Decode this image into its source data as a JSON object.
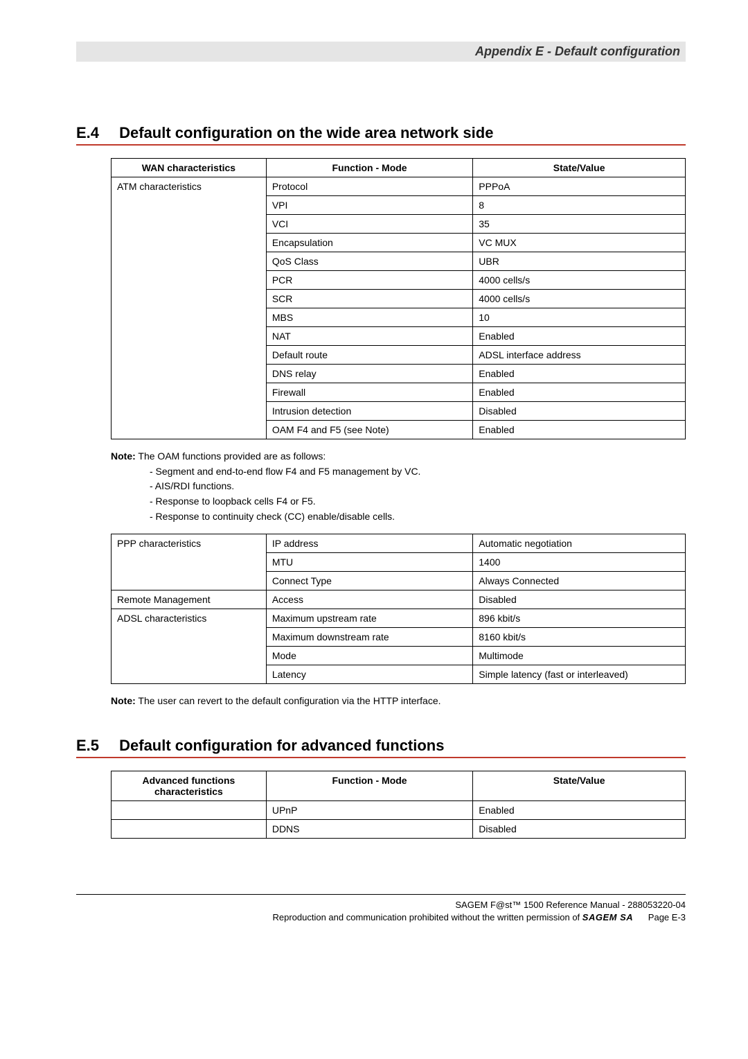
{
  "header": {
    "title": "Appendix E - Default configuration"
  },
  "sections": {
    "e4": {
      "num": "E.4",
      "title": "Default configuration on the wide area network side",
      "table1": {
        "headers": [
          "WAN characteristics",
          "Function - Mode",
          "State/Value"
        ],
        "group": "ATM characteristics",
        "rows": [
          {
            "f": "Protocol",
            "v": "PPPoA"
          },
          {
            "f": "VPI",
            "v": "8"
          },
          {
            "f": "VCI",
            "v": "35"
          },
          {
            "f": "Encapsulation",
            "v": "VC MUX"
          },
          {
            "f": "QoS Class",
            "v": "UBR"
          },
          {
            "f": "PCR",
            "v": "4000 cells/s"
          },
          {
            "f": "SCR",
            "v": "4000 cells/s"
          },
          {
            "f": "MBS",
            "v": "10"
          },
          {
            "f": "NAT",
            "v": "Enabled"
          },
          {
            "f": "Default route",
            "v": "ADSL interface address"
          },
          {
            "f": "DNS relay",
            "v": "Enabled"
          },
          {
            "f": "Firewall",
            "v": "Enabled"
          },
          {
            "f": "Intrusion detection",
            "v": "Disabled"
          },
          {
            "f": "OAM F4 and F5 (see Note)",
            "v": "Enabled"
          }
        ]
      },
      "note1": {
        "label": "Note:",
        "intro": "The OAM functions provided are as follows:",
        "items": [
          "- Segment and end-to-end flow F4 and F5 management by VC.",
          "- AIS/RDI functions.",
          "- Response to loopback cells F4 or F5.",
          "- Response to continuity check (CC) enable/disable cells."
        ]
      },
      "table2": {
        "groups": [
          {
            "name": "PPP characteristics",
            "rows": [
              {
                "f": "IP address",
                "v": "Automatic negotiation"
              },
              {
                "f": "MTU",
                "v": "1400"
              },
              {
                "f": "Connect Type",
                "v": "Always Connected"
              }
            ]
          },
          {
            "name": "Remote Management",
            "rows": [
              {
                "f": "Access",
                "v": "Disabled"
              }
            ]
          },
          {
            "name": "ADSL characteristics",
            "rows": [
              {
                "f": "Maximum upstream rate",
                "v": "896 kbit/s"
              },
              {
                "f": "Maximum downstream rate",
                "v": "8160 kbit/s"
              },
              {
                "f": "Mode",
                "v": "Multimode"
              },
              {
                "f": "Latency",
                "v": "Simple latency (fast or interleaved)"
              }
            ]
          }
        ]
      },
      "note2": {
        "label": "Note:",
        "text": "The user can revert to the default configuration via the HTTP interface."
      }
    },
    "e5": {
      "num": "E.5",
      "title": "Default configuration for advanced functions",
      "table": {
        "headers": [
          "Advanced functions characteristics",
          "Function - Mode",
          "State/Value"
        ],
        "rows": [
          {
            "a": "",
            "f": "UPnP",
            "v": "Enabled"
          },
          {
            "a": "",
            "f": "DDNS",
            "v": "Disabled"
          }
        ]
      }
    }
  },
  "footer": {
    "line1_a": "SAGEM F@st™ 1500 Reference Manual - 288053220-04",
    "line2_a": "Reproduction and communication prohibited without the written permission of ",
    "line2_brand": "SAGEM SA",
    "line2_page": "Page E-3"
  }
}
